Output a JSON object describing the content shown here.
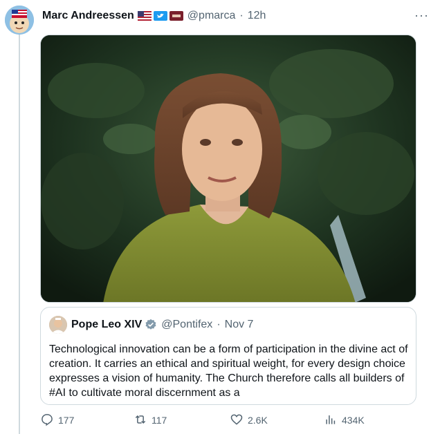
{
  "post": {
    "author_name": "Marc Andreessen",
    "author_handle": "@pmarca",
    "separator": "·",
    "time": "12h",
    "more_label": "···"
  },
  "quote": {
    "author_name": "Pope Leo XIV",
    "author_handle": "@Pontifex",
    "separator": "·",
    "date": "Nov 7",
    "text": "Technological innovation can be a form of participation in the divine act of creation. It carries an ethical and spiritual weight, for every design choice expresses a vision of humanity. The Church therefore calls all builders of #AI to cultivate moral discernment as a"
  },
  "actions": {
    "replies": "177",
    "reposts": "117",
    "likes": "2.6K",
    "views": "434K"
  },
  "icons": {
    "badges": [
      "us-flag-icon",
      "twitter-bird-icon",
      "a16z-icon"
    ],
    "verified": "verified-badge-icon",
    "reply": "reply-icon",
    "repost": "repost-icon",
    "like": "heart-icon",
    "views": "views-icon"
  },
  "colors": {
    "text": "#0f1419",
    "secondary": "#536471",
    "border": "#cfd9de",
    "twitter_blue": "#1d9bf0"
  }
}
